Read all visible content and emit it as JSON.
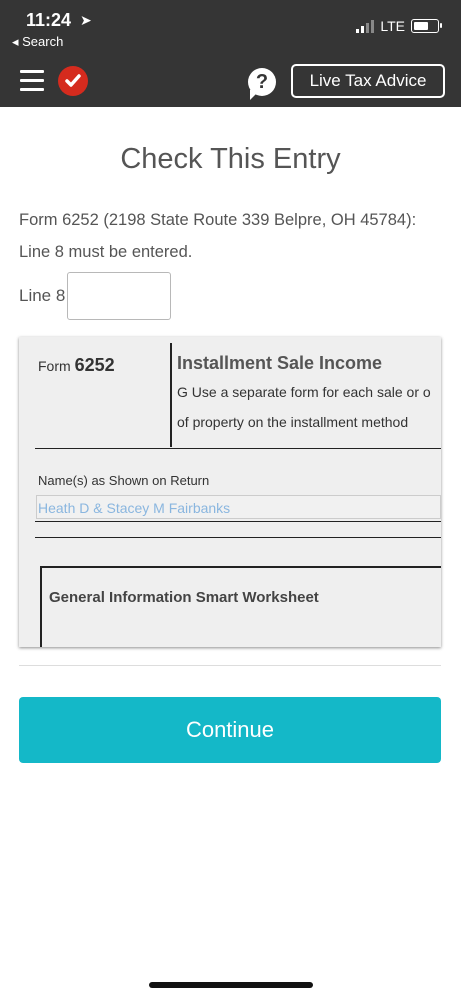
{
  "status_bar": {
    "time": "11:24",
    "location_icon": "location-arrow-icon",
    "back_label": "◂ Search",
    "network": "LTE"
  },
  "header": {
    "help_symbol": "?",
    "live_advice_label": "Live Tax Advice"
  },
  "page": {
    "title": "Check This Entry",
    "message": "Form 6252 (2198 State Route 339 Belpre, OH 45784): Line 8 must be entered.",
    "line8_label": "Line 8",
    "line8_value": ""
  },
  "form_preview": {
    "form_prefix": "Form",
    "form_number": "6252",
    "title": "Installment Sale Income",
    "subtitle_1": "G Use a separate form for each sale or o",
    "subtitle_2": "of property on the installment method",
    "names_label": "Name(s) as Shown on Return",
    "names_value": "Heath D & Stacey M Fairbanks",
    "worksheet_title": "General Information Smart Worksheet"
  },
  "actions": {
    "continue_label": "Continue"
  },
  "colors": {
    "header_bg": "#353535",
    "accent": "#14b8c8",
    "logo_red": "#d52b1e"
  }
}
